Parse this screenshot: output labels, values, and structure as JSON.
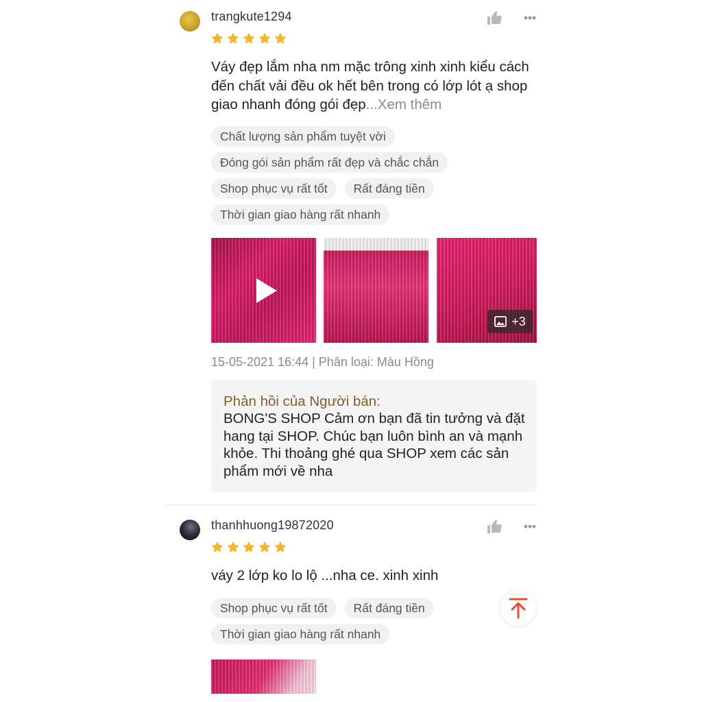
{
  "reviews": [
    {
      "username": "trangkute1294",
      "rating": 5,
      "text": "Váy đẹp lắm nha nm mặc trông xinh xinh kiểu cách đến chất vải đều ok hết bên trong có lớp lót ạ shop giao nhanh đóng gói đẹp",
      "see_more": "...Xem thêm",
      "tags": [
        "Chất lượng sản phẩm tuyệt vời",
        "Đóng gói sản phẩm rất đẹp và chắc chắn",
        "Shop phục vụ rất tốt",
        "Rất đáng tiền",
        "Thời gian giao hàng rất nhanh"
      ],
      "media_more_count": "+3",
      "meta": "15-05-2021 16:44 | Phân loại: Màu Hồng",
      "seller_reply_title": "Phản hồi của Người bán:",
      "seller_reply_text": "BONG'S SHOP Cảm ơn bạn đã tin tưởng và đặt hang tại SHOP. Chúc bạn luôn bình an và mạnh khỏe. Thi thoảng ghé qua SHOP xem các sản phẩm mới về nha"
    },
    {
      "username": "thanhhuong19872020",
      "rating": 5,
      "text": "váy 2 lớp ko lo lộ ...nha ce. xinh xinh",
      "tags": [
        "Shop phục vụ rất tốt",
        "Rất đáng tiền",
        "Thời gian giao hàng rất nhanh"
      ]
    }
  ],
  "icons": {
    "like": "thumbs-up-icon",
    "more": "more-options-icon",
    "play": "play-icon",
    "gallery": "image-icon",
    "scroll_top": "arrow-up-to-top-icon"
  },
  "colors": {
    "star": "#f5b52a",
    "accent": "#ee4d2d",
    "reply_title": "#8a5a2a"
  }
}
